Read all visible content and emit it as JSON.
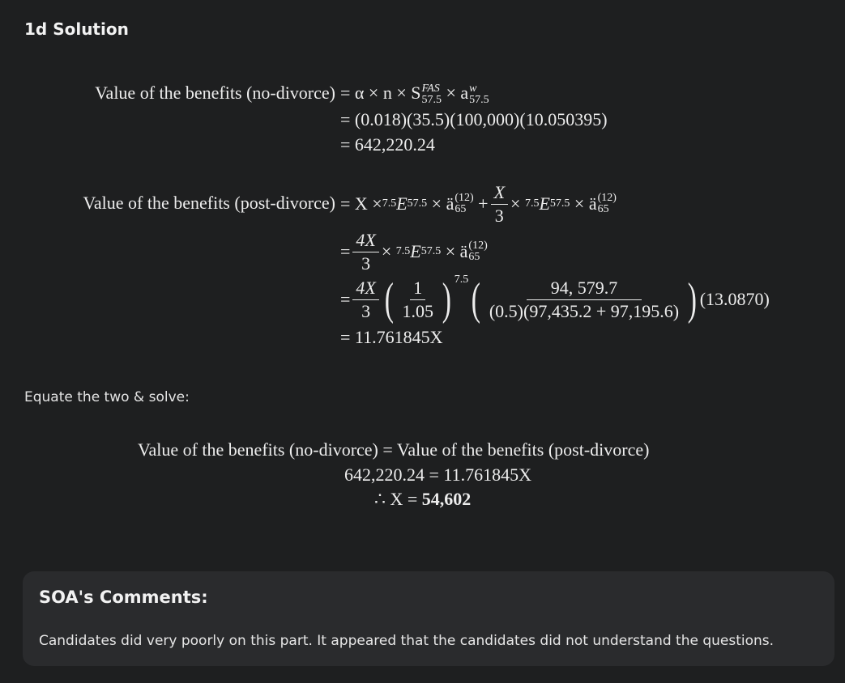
{
  "heading": "1d Solution",
  "eq1": {
    "label": "Value of the benefits (no-divorce)",
    "line1": "= α × n × S",
    "line1_sup": "FAS",
    "line1_sub": "57.5",
    "line1_tail": "× a",
    "line1_tail_sup": "w",
    "line1_tail_sub": "57.5",
    "line2": "= (0.018)(35.5)(100,000)(10.050395)",
    "line3": "= 642,220.24"
  },
  "eq2": {
    "label": "Value of the benefits (post-divorce)",
    "line1_a": "= X × ",
    "pre_sub": "7.5",
    "E": "E",
    "E_sub": "57.5",
    "times_a": "× ä",
    "a_sup": "(12)",
    "a_sub": "65",
    "plus": "+",
    "frac_num": "X",
    "frac_den": "3",
    "four_x": "4X",
    "one": "1",
    "one_o_five": "1.05",
    "exp": "7.5",
    "big_num": "94, 579.7",
    "big_den": "(0.5)(97,435.2 + 97,195.6)",
    "tail": "(13.0870)",
    "eq": "=",
    "times": "×",
    "result": "= 11.761845X"
  },
  "equate_text": "Equate the two & solve:",
  "eq3": {
    "line1": "Value of the benefits (no-divorce) = Value of the benefits (post-divorce)",
    "line2": "642,220.24 = 11.761845X",
    "line3_pre": "∴ X = ",
    "line3_bold": "54,602"
  },
  "comments": {
    "title": "SOA's Comments:",
    "text": "Candidates did very poorly on this part. It appeared that the candidates did not understand the questions."
  }
}
